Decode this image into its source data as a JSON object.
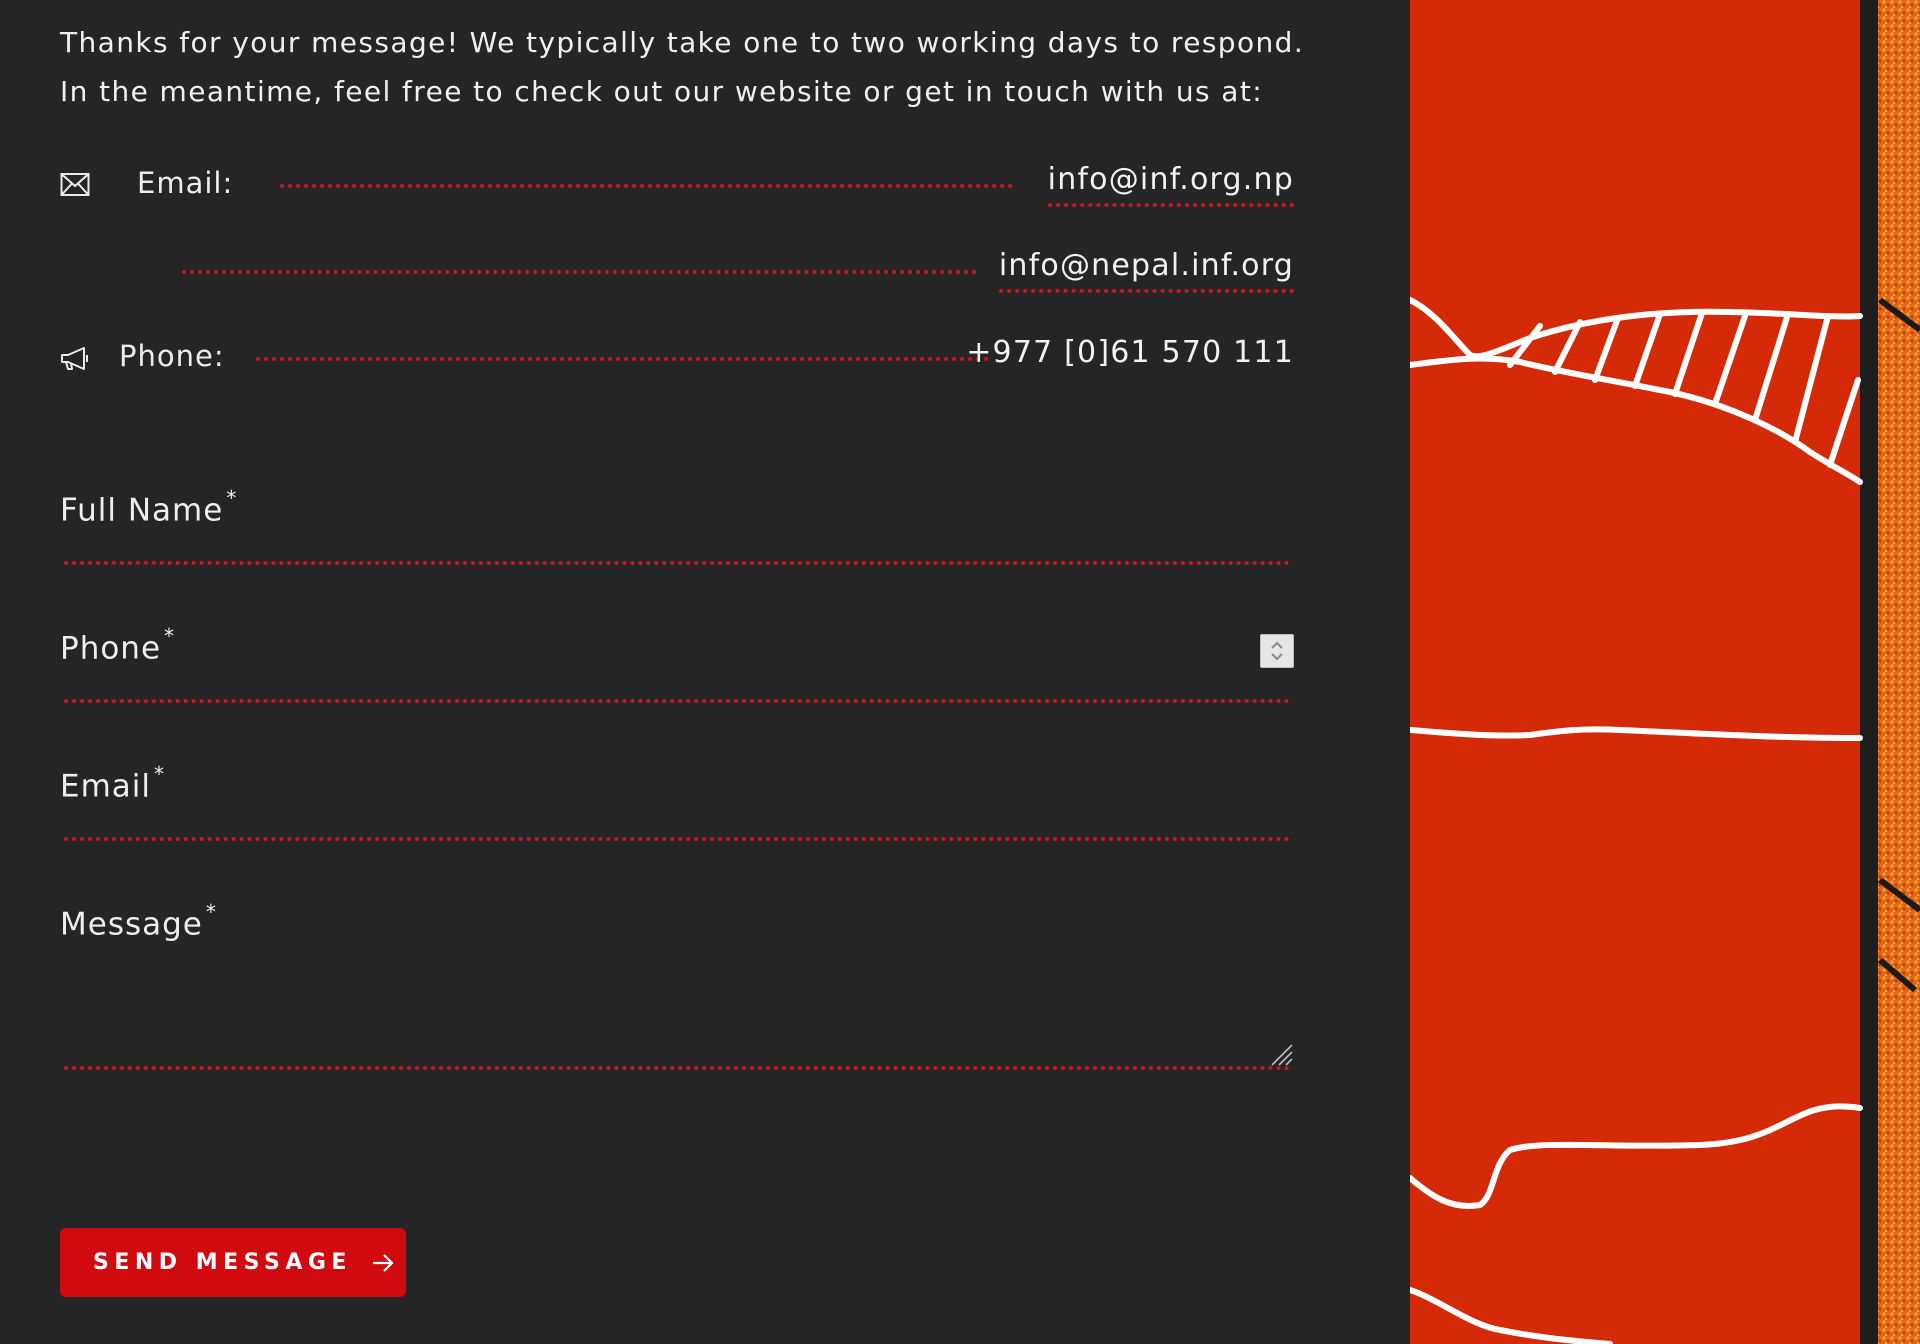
{
  "intro": {
    "line1": "Thanks for your message! We typically take one to two working days to respond.",
    "line2": "In the meantime, feel free to check out our website or get in touch with us at:"
  },
  "contact": {
    "email_label": "Email:",
    "email_primary": "info@inf.org.np",
    "email_secondary": "info@nepal.inf.org",
    "phone_label": "Phone:",
    "phone_value": "+977 [0]61 570 111"
  },
  "form": {
    "full_name_label": "Full Name",
    "phone_label": "Phone",
    "email_label": "Email",
    "message_label": "Message",
    "required_mark": "*",
    "submit_label": "SEND MESSAGE"
  },
  "icons": {
    "email": "envelope-icon",
    "phone": "megaphone-icon",
    "submit": "arrow-right-icon",
    "stepper": "spin-stepper-icon",
    "resize": "resize-grip-icon"
  },
  "colors": {
    "background": "#252525",
    "accent": "#d10a10",
    "dotted_rule": "#d0131c",
    "text": "#ececec",
    "art_red": "#d42a07",
    "art_orange": "#e05a10"
  }
}
